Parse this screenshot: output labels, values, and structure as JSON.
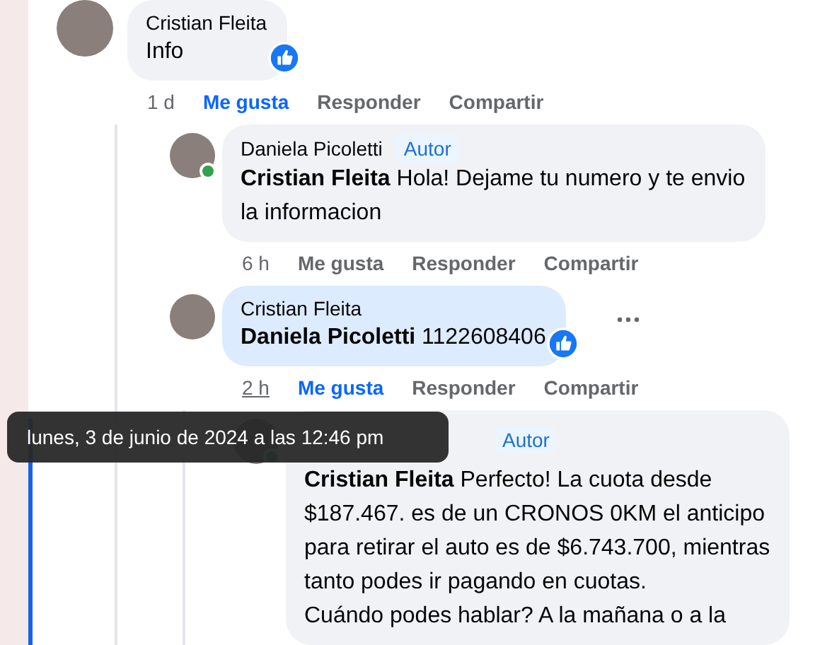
{
  "comments": [
    {
      "author": "Cristian Fleita",
      "text": "Info",
      "highlighted": false,
      "reacted": true,
      "time": "1 d",
      "time_hovered": false,
      "liked": true,
      "actions": [
        "Me gusta",
        "Responder",
        "Compartir"
      ],
      "replies": [
        {
          "author": "Daniela Picoletti",
          "author_badge": "Autor",
          "online": true,
          "text": "**Cristian Fleita** Hola! Dejame tu numero y te envio\nla informacion",
          "highlighted": false,
          "time": "6 h",
          "time_hovered": false,
          "liked": false,
          "actions": [
            "Me gusta",
            "Responder",
            "Compartir"
          ]
        },
        {
          "author": "Cristian Fleita",
          "text": "**Daniela Picoletti** 1122608406",
          "highlighted": true,
          "reacted": true,
          "more_menu": true,
          "time": "2 h",
          "time_hovered": true,
          "liked": true,
          "actions": [
            "Me gusta",
            "Responder",
            "Compartir"
          ],
          "replies": [
            {
              "author_badge": "Autor",
              "online": true,
              "text": "**Cristian Fleita** Perfecto! La cuota desde\n$187.467. es de un CRONOS 0KM el anticipo\npara retirar el auto es de $6.743.700, mientras\ntanto podes ir pagando en cuotas.\nCuándo podes hablar? A la mañana o a la",
              "highlighted": false
            }
          ]
        }
      ]
    }
  ],
  "tooltip": {
    "text": "lunes, 3 de junio de 2024 a las 12:46 pm"
  }
}
